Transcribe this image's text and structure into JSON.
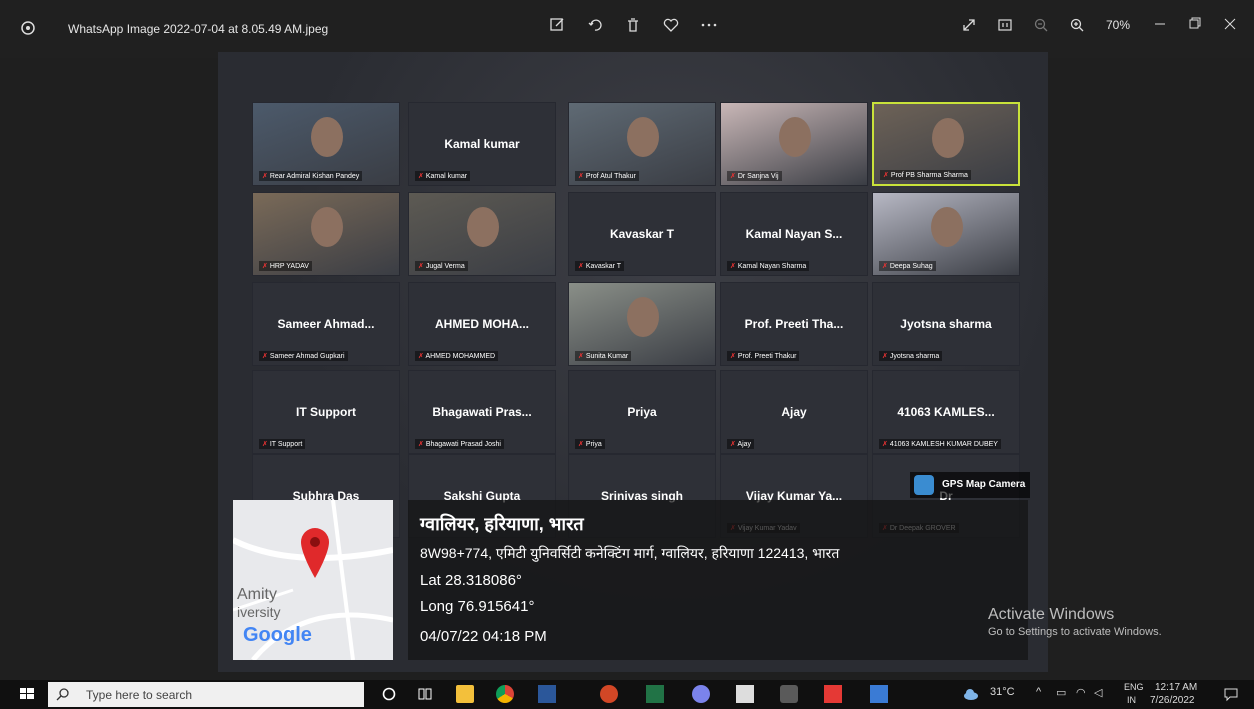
{
  "window": {
    "title": "WhatsApp Image 2022-07-04 at 8.05.49 AM.jpeg",
    "zoom": "70%"
  },
  "tiles": [
    {
      "name": "",
      "label": "Rear Admiral Kishan Pandey",
      "video": true
    },
    {
      "name": "Kamal kumar",
      "label": "Kamal kumar",
      "video": false
    },
    {
      "name": "",
      "label": "Prof Atul Thakur",
      "video": true
    },
    {
      "name": "",
      "label": "Dr Sanjna Vij",
      "video": true
    },
    {
      "name": "",
      "label": "Prof PB Sharma Sharma",
      "video": true
    },
    {
      "name": "",
      "label": "HRP YADAV",
      "video": true
    },
    {
      "name": "",
      "label": "Jugal Verma",
      "video": true
    },
    {
      "name": "Kavaskar T",
      "label": "Kavaskar T",
      "video": false
    },
    {
      "name": "Kamal Nayan S...",
      "label": "Kamal Nayan Sharma",
      "video": false
    },
    {
      "name": "",
      "label": "Deepa Suhag",
      "video": true
    },
    {
      "name": "Sameer Ahmad...",
      "label": "Sameer Ahmad Gupkari",
      "video": false
    },
    {
      "name": "AHMED MOHA...",
      "label": "AHMED MOHAMMED",
      "video": false
    },
    {
      "name": "",
      "label": "Sunita Kumar",
      "video": true
    },
    {
      "name": "Prof. Preeti Tha...",
      "label": "Prof. Preeti Thakur",
      "video": false
    },
    {
      "name": "Jyotsna sharma",
      "label": "Jyotsna sharma",
      "video": false
    },
    {
      "name": "IT Support",
      "label": "IT Support",
      "video": false
    },
    {
      "name": "Bhagawati Pras...",
      "label": "Bhagawati Prasad Joshi",
      "video": false
    },
    {
      "name": "Priya",
      "label": "Priya",
      "video": false
    },
    {
      "name": "Ajay",
      "label": "Ajay",
      "video": false
    },
    {
      "name": "41063 KAMLES...",
      "label": "41063 KAMLESH KUMAR DUBEY",
      "video": false
    },
    {
      "name": "Subhra Das",
      "label": "",
      "video": false
    },
    {
      "name": "Sakshi Gupta",
      "label": "",
      "video": false
    },
    {
      "name": "Srinivas singh",
      "label": "",
      "video": false
    },
    {
      "name": "Vijay Kumar Ya...",
      "label": "Vijay Kumar Yadav",
      "video": false
    },
    {
      "name": "Dr",
      "label": "Dr Deepak GROVER",
      "video": false
    }
  ],
  "gps": {
    "badge": "GPS Map Camera",
    "title": "ग्वालियर, हरियाणा, भारत",
    "address": "8W98+774, एमिटी युनिवर्सिटी कनेक्टिंग मार्ग, ग्वालियर, हरियाणा 122413, भारत",
    "lat": "Lat 28.318086°",
    "long": "Long 76.915641°",
    "datetime": "04/07/22 04:18 PM",
    "map_text_1": "Amity",
    "map_text_2": "iversity",
    "map_brand": "Google"
  },
  "activate": {
    "title": "Activate Windows",
    "subtitle": "Go to Settings to activate Windows."
  },
  "taskbar": {
    "search_placeholder": "Type here to search",
    "weather": "31°C",
    "lang1": "ENG",
    "lang2": "IN",
    "time": "12:17 AM",
    "date": "7/26/2022"
  }
}
